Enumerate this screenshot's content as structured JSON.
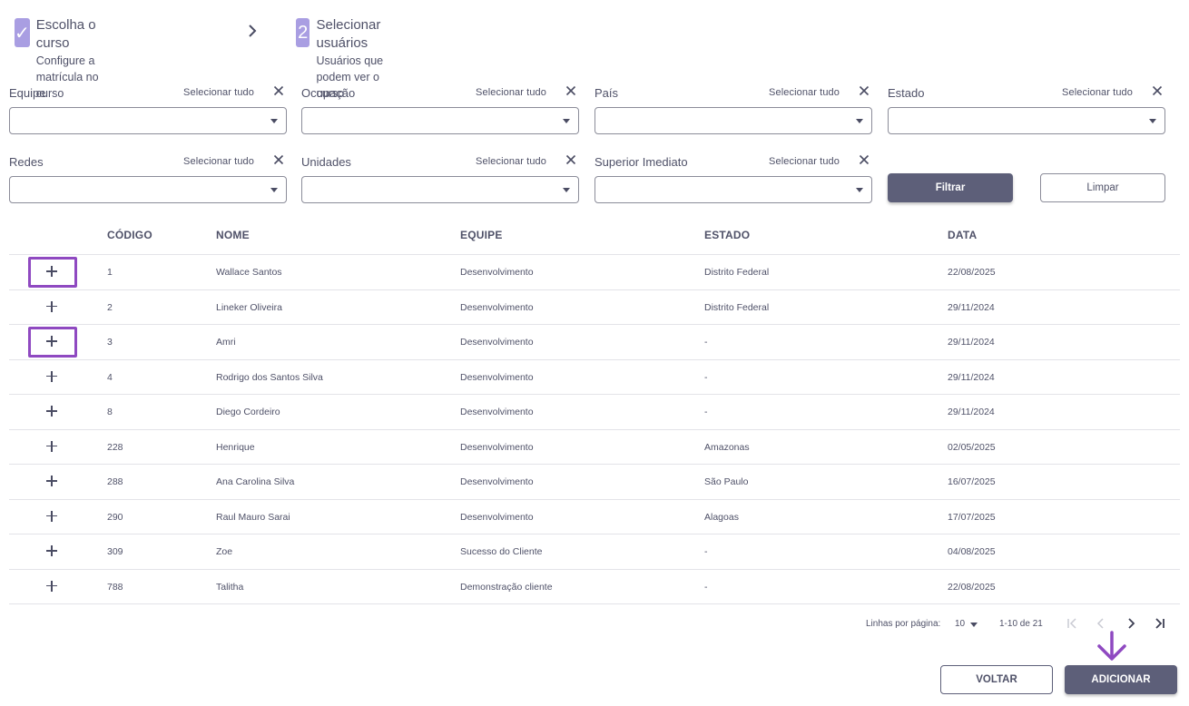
{
  "stepper": {
    "step1": {
      "badge": "✓",
      "title": "Escolha o curso",
      "subtitle": "Configure a matrícula no curso"
    },
    "step2": {
      "badge": "2",
      "title": "Selecionar usuários",
      "subtitle": "Usuários que podem ver o curso"
    }
  },
  "filters": [
    {
      "label": "Equipe",
      "select_all": "Selecionar tudo",
      "value": ""
    },
    {
      "label": "Ocupação",
      "select_all": "Selecionar tudo",
      "value": ""
    },
    {
      "label": "País",
      "select_all": "Selecionar tudo",
      "value": ""
    },
    {
      "label": "Estado",
      "select_all": "Selecionar tudo",
      "value": ""
    },
    {
      "label": "Redes",
      "select_all": "Selecionar tudo",
      "value": ""
    },
    {
      "label": "Unidades",
      "select_all": "Selecionar tudo",
      "value": ""
    },
    {
      "label": "Superior Imediato",
      "select_all": "Selecionar tudo",
      "value": ""
    }
  ],
  "actions": {
    "filter_label": "Filtrar",
    "clear_label": "Limpar"
  },
  "table": {
    "headers": {
      "codigo": "CÓDIGO",
      "nome": "NOME",
      "equipe": "EQUIPE",
      "estado": "ESTADO",
      "data": "DATA"
    },
    "rows": [
      {
        "codigo": "1",
        "nome": "Wallace Santos",
        "equipe": "Desenvolvimento",
        "estado": "Distrito Federal",
        "data": "22/08/2025",
        "highlighted": true
      },
      {
        "codigo": "2",
        "nome": "Lineker Oliveira",
        "equipe": "Desenvolvimento",
        "estado": "Distrito Federal",
        "data": "29/11/2024",
        "highlighted": false
      },
      {
        "codigo": "3",
        "nome": "Amri",
        "equipe": "Desenvolvimento",
        "estado": "-",
        "data": "29/11/2024",
        "highlighted": true
      },
      {
        "codigo": "4",
        "nome": "Rodrigo dos Santos Silva",
        "equipe": "Desenvolvimento",
        "estado": "-",
        "data": "29/11/2024",
        "highlighted": false
      },
      {
        "codigo": "8",
        "nome": "Diego Cordeiro",
        "equipe": "Desenvolvimento",
        "estado": "-",
        "data": "29/11/2024",
        "highlighted": false
      },
      {
        "codigo": "228",
        "nome": "Henrique",
        "equipe": "Desenvolvimento",
        "estado": "Amazonas",
        "data": "02/05/2025",
        "highlighted": false
      },
      {
        "codigo": "288",
        "nome": "Ana Carolina Silva",
        "equipe": "Desenvolvimento",
        "estado": "São Paulo",
        "data": "16/07/2025",
        "highlighted": false
      },
      {
        "codigo": "290",
        "nome": "Raul Mauro Sarai",
        "equipe": "Desenvolvimento",
        "estado": "Alagoas",
        "data": "17/07/2025",
        "highlighted": false
      },
      {
        "codigo": "309",
        "nome": "Zoe",
        "equipe": "Sucesso do Cliente",
        "estado": "-",
        "data": "04/08/2025",
        "highlighted": false
      },
      {
        "codigo": "788",
        "nome": "Talitha",
        "equipe": "Demonstração cliente",
        "estado": "-",
        "data": "22/08/2025",
        "highlighted": false
      }
    ]
  },
  "pagination": {
    "rows_label": "Linhas por página:",
    "rows_per_page": "10",
    "range": "1-10 de 21"
  },
  "footer": {
    "back_label": "VOLTAR",
    "add_label": "ADICIONAR"
  },
  "colors": {
    "accent": "#a99ee2",
    "primary_button": "#5d5f79",
    "highlight": "#8f49c1",
    "text": "#4f5168"
  }
}
